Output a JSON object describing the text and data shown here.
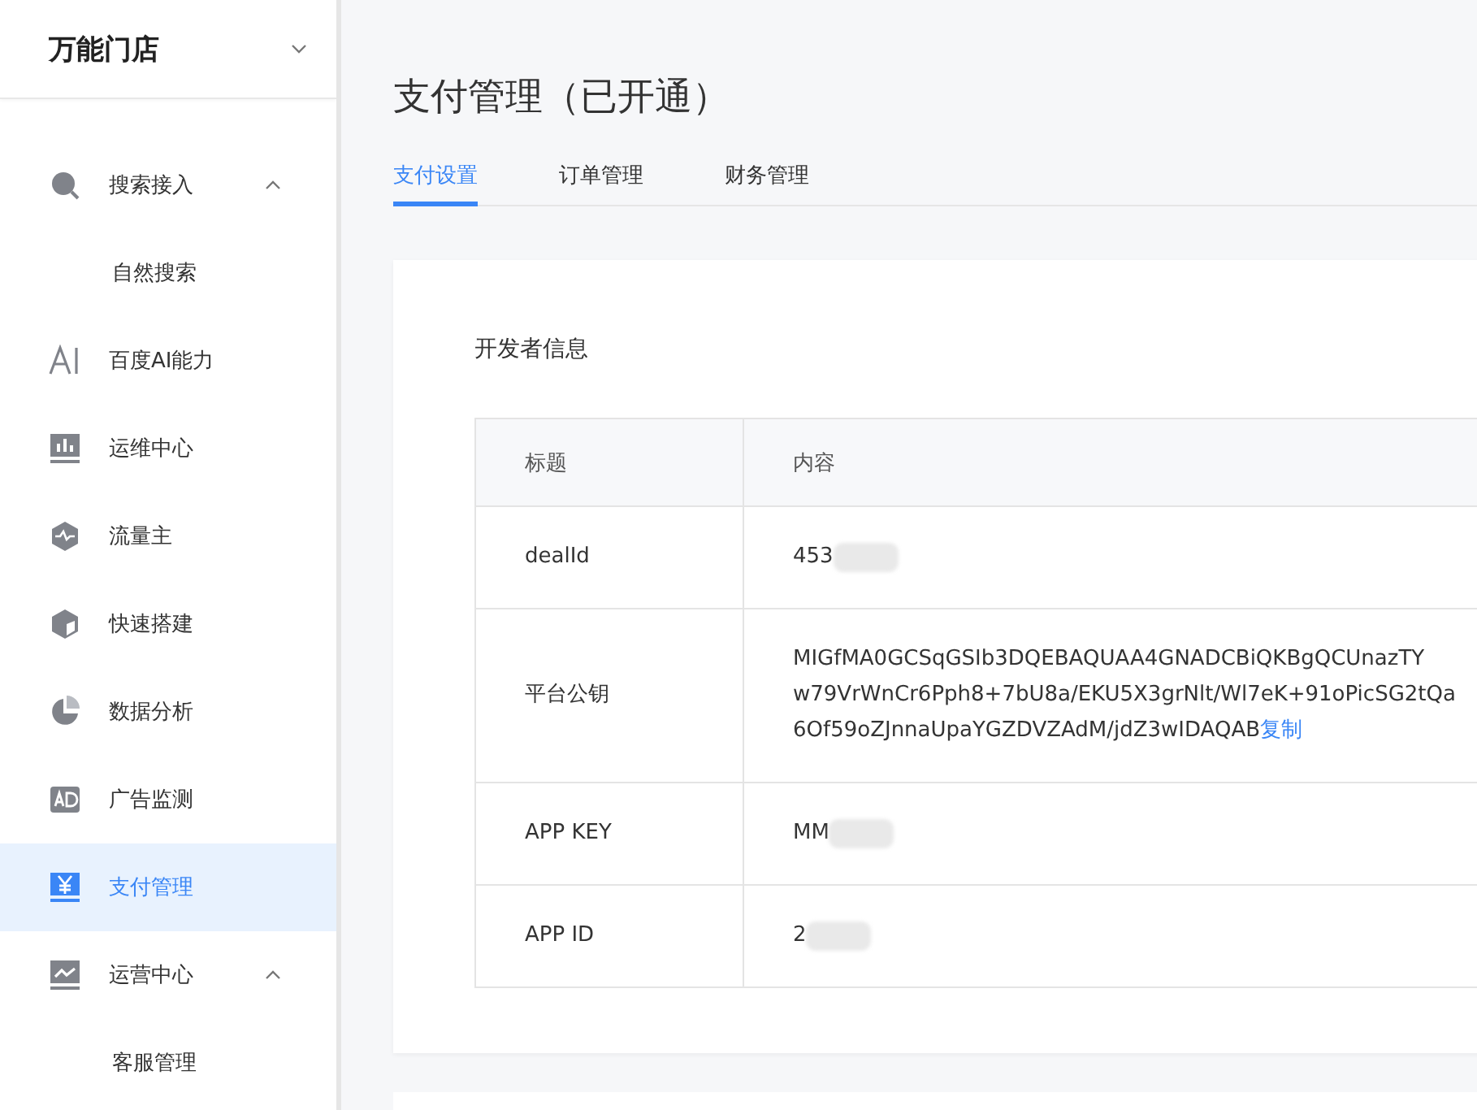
{
  "store": {
    "name": "万能门店"
  },
  "sidebar": {
    "items": [
      {
        "label": "搜索接入",
        "selected": false,
        "expanded": true,
        "children": [
          {
            "label": "自然搜索",
            "selected": false
          }
        ]
      },
      {
        "label": "百度AI能力",
        "selected": false
      },
      {
        "label": "运维中心",
        "selected": false
      },
      {
        "label": "流量主",
        "selected": false
      },
      {
        "label": "快速搭建",
        "selected": false
      },
      {
        "label": "数据分析",
        "selected": false
      },
      {
        "label": "广告监测",
        "selected": false
      },
      {
        "label": "支付管理",
        "selected": true
      },
      {
        "label": "运营中心",
        "selected": false,
        "expanded": true,
        "children": [
          {
            "label": "客服管理",
            "selected": false
          }
        ]
      }
    ]
  },
  "page": {
    "title": "支付管理（已开通）",
    "tabs": [
      {
        "label": "支付设置",
        "selected": true
      },
      {
        "label": "订单管理",
        "selected": false
      },
      {
        "label": "财务管理",
        "selected": false
      }
    ],
    "section_title": "开发者信息",
    "table": {
      "columns": [
        "标题",
        "内容"
      ],
      "rows": [
        {
          "title": "dealId",
          "lines": [
            "453"
          ],
          "blurred": true
        },
        {
          "title": "平台公钥",
          "lines": [
            "MIGfMA0GCSqGSIb3DQEBAQUAA4GNADCBiQKBgQCUnazTY",
            "w79VrWnCr6Pph8+7bU8a/EKU5X3grNlt/Wl7eK+91oPicSG2tQa",
            "6Of59oZJnnaUpaYGZDVZAdM/jdZ3wIDAQAB"
          ],
          "link": "复制",
          "blurred": false
        },
        {
          "title": "APP KEY",
          "lines": [
            "MM"
          ],
          "blurred": true
        },
        {
          "title": "APP ID",
          "lines": [
            "2"
          ],
          "blurred": true
        }
      ]
    }
  }
}
